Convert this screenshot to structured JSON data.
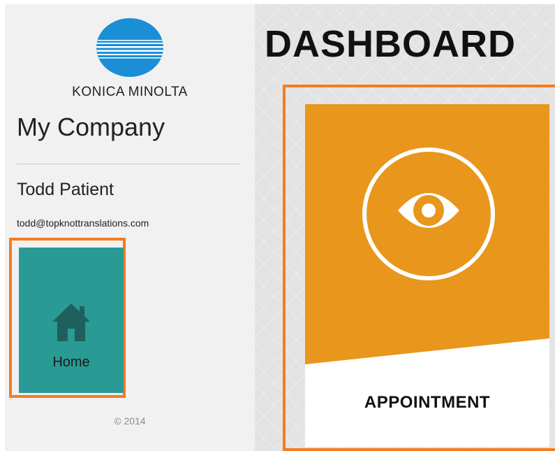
{
  "sidebar": {
    "logo": {
      "icon": "konica-minolta-globe-icon",
      "text": "KONICA MINOLTA",
      "color": "#1a8fd6"
    },
    "company_name": "My Company",
    "user": {
      "name": "Todd Patient",
      "email": "todd@topknottranslations.com"
    },
    "nav": [
      {
        "label": "Home",
        "icon": "home-icon",
        "highlighted": true,
        "color": "#2a9a95"
      }
    ],
    "copyright": "© 2014"
  },
  "main": {
    "title": "DASHBOARD",
    "tiles": [
      {
        "label": "APPOINTMENT",
        "icon": "eye-icon",
        "highlighted": true,
        "color": "#e8961c"
      }
    ]
  },
  "colors": {
    "highlight": "#f47c20",
    "sidebar_bg": "#f1f1f1",
    "main_bg": "#e3e3e3"
  }
}
